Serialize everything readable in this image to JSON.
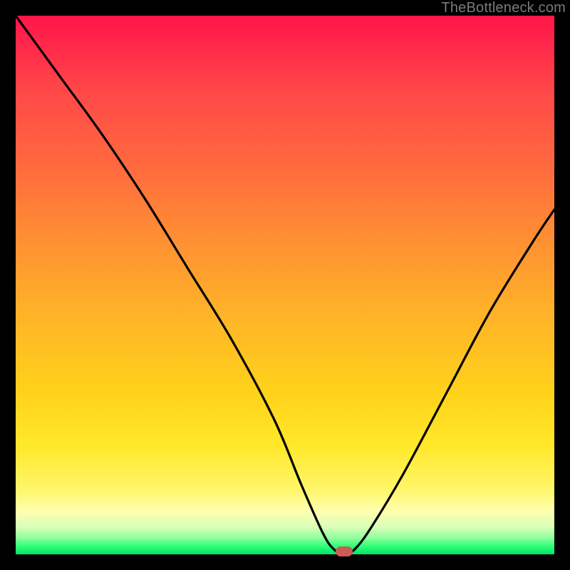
{
  "watermark": "TheBottleneck.com",
  "chart_data": {
    "type": "line",
    "title": "",
    "xlabel": "",
    "ylabel": "",
    "xlim": [
      0,
      100
    ],
    "ylim": [
      0,
      100
    ],
    "gradient_field": {
      "description": "Vertical background: value 100 (red) at top to value 0 (green) at bottom",
      "stops": [
        {
          "pos": 0,
          "color": "#ff1548",
          "meaning": "worst"
        },
        {
          "pos": 50,
          "color": "#ffb228",
          "meaning": "mid"
        },
        {
          "pos": 92,
          "color": "#ffffb0",
          "meaning": "near-best"
        },
        {
          "pos": 100,
          "color": "#00e46a",
          "meaning": "best"
        }
      ]
    },
    "series": [
      {
        "name": "bottleneck-curve",
        "x": [
          0,
          8,
          16,
          24,
          32,
          40,
          48,
          53,
          57,
          59,
          61,
          63,
          66,
          72,
          80,
          88,
          96,
          100
        ],
        "y": [
          100,
          89,
          78,
          66,
          53,
          40,
          25,
          13,
          4,
          1,
          0,
          1,
          5,
          15,
          30,
          45,
          58,
          64
        ]
      }
    ],
    "marker": {
      "x": 61,
      "y": 0,
      "shape": "pill",
      "color": "#cc5a55"
    },
    "annotations": []
  }
}
